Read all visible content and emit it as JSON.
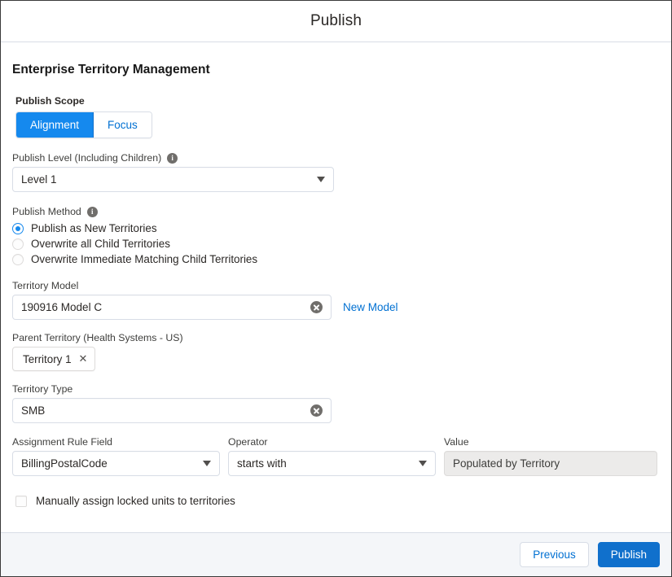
{
  "modal": {
    "title": "Publish",
    "section_heading": "Enterprise Territory Management"
  },
  "publish_scope": {
    "label": "Publish Scope",
    "options": [
      {
        "label": "Alignment",
        "selected": true
      },
      {
        "label": "Focus",
        "selected": false
      }
    ]
  },
  "publish_level": {
    "label": "Publish Level (Including Children)",
    "info_icon": "info-icon",
    "value": "Level 1",
    "caret_icon": "chevron-down-icon"
  },
  "publish_method": {
    "label": "Publish Method",
    "info_icon": "info-icon",
    "options": [
      {
        "label": "Publish as New Territories",
        "selected": true
      },
      {
        "label": "Overwrite all Child Territories",
        "selected": false
      },
      {
        "label": "Overwrite Immediate Matching Child Territories",
        "selected": false
      }
    ]
  },
  "territory_model": {
    "label": "Territory Model",
    "value": "190916 Model C",
    "clear_icon": "clear-icon",
    "new_model_link": "New Model"
  },
  "parent_territory": {
    "label": "Parent Territory (Health Systems - US)",
    "pill": "Territory 1",
    "pill_remove_icon": "close-icon"
  },
  "territory_type": {
    "label": "Territory Type",
    "value": "SMB",
    "clear_icon": "clear-icon"
  },
  "assignment_rule": {
    "field_label": "Assignment Rule Field",
    "field_value": "BillingPostalCode",
    "operator_label": "Operator",
    "operator_value": "starts with",
    "value_label": "Value",
    "value_value": "Populated by Territory",
    "value_disabled": true
  },
  "manual_assign": {
    "label": "Manually assign locked units to territories",
    "checked": false
  },
  "footer": {
    "previous_label": "Previous",
    "publish_label": "Publish"
  },
  "colors": {
    "brand_blue": "#1589ee",
    "brand_blue_dark": "#1070cc",
    "link_blue": "#0070d2",
    "border": "#d8dde6",
    "footer_bg": "#f4f6f9",
    "disabled_bg": "#ecebea",
    "icon_grey": "#706e6b"
  }
}
